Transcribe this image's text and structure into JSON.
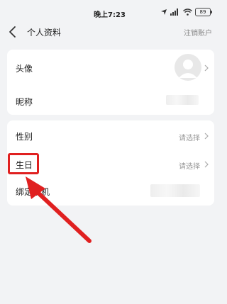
{
  "status_bar": {
    "time": "晚上7:23",
    "battery": "89"
  },
  "header": {
    "title": "个人资料",
    "action": "注销账户"
  },
  "profile": {
    "avatar_label": "头像",
    "nickname_label": "昵称"
  },
  "details": {
    "gender_label": "性别",
    "gender_value": "请选择",
    "birthday_label": "生日",
    "birthday_value": "请选择",
    "phone_label": "绑定手机"
  },
  "colors": {
    "annotation": "#e02020",
    "background": "#f2f3f5"
  }
}
